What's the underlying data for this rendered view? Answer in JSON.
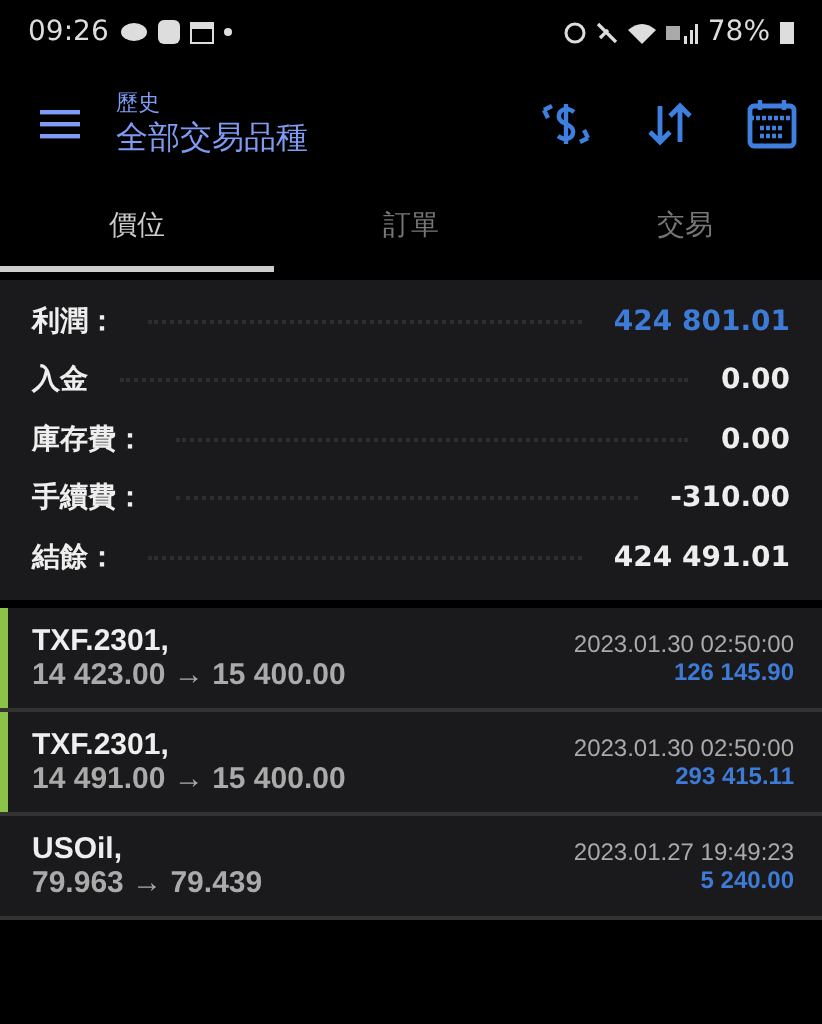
{
  "status_bar": {
    "time": "09:26",
    "battery": "78%"
  },
  "header": {
    "subtitle": "歷史",
    "title": "全部交易品種"
  },
  "tabs": [
    {
      "label": "價位",
      "selected": true
    },
    {
      "label": "訂單",
      "selected": false
    },
    {
      "label": "交易",
      "selected": false
    }
  ],
  "summary": [
    {
      "label": "利潤：",
      "value": "424 801.01",
      "highlight": true
    },
    {
      "label": "入金",
      "value": "0.00",
      "highlight": false
    },
    {
      "label": "庫存費：",
      "value": "0.00",
      "highlight": false
    },
    {
      "label": "手續費：",
      "value": "-310.00",
      "highlight": false
    },
    {
      "label": "結餘：",
      "value": "424 491.01",
      "highlight": false
    }
  ],
  "trades": [
    {
      "symbol": "TXF.2301,",
      "prices": "14 423.00 → 15 400.00",
      "time": "2023.01.30 02:50:00",
      "profit": "126 145.90",
      "flagged": true
    },
    {
      "symbol": "TXF.2301,",
      "prices": "14 491.00 → 15 400.00",
      "time": "2023.01.30 02:50:00",
      "profit": "293 415.11",
      "flagged": true
    },
    {
      "symbol": "USOil,",
      "prices": "79.963 → 79.439",
      "time": "2023.01.27 19:49:23",
      "profit": "5 240.00",
      "flagged": false
    }
  ]
}
